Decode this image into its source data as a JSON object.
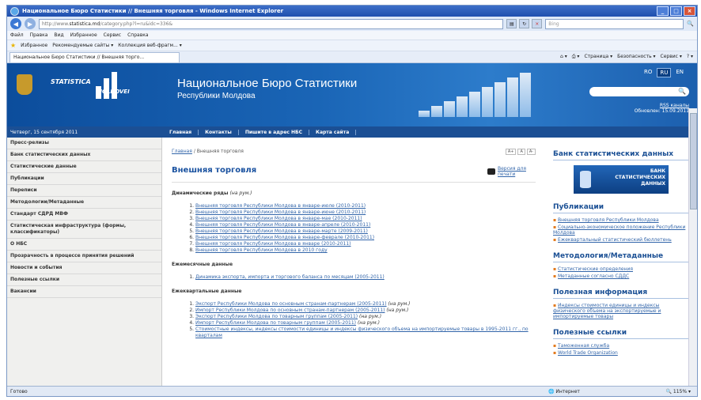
{
  "window": {
    "title": "Национальное Бюро Статистики // Внешняя торговля - Windows Internet Explorer"
  },
  "address": {
    "url_prefix": "http://www.",
    "url_host": "statistica.md",
    "url_rest": "/category.php?l=ru&idc=336&",
    "search_placeholder": "Bing"
  },
  "menubar": [
    "Файл",
    "Правка",
    "Вид",
    "Избранное",
    "Сервис",
    "Справка"
  ],
  "favorites": {
    "label": "Избранное",
    "item1": "Рекомендуемые сайты ▾",
    "item2": "Коллекция веб-фрагм... ▾"
  },
  "tab": {
    "label": "Национальное Бюро Статистики // Внешняя торго..."
  },
  "commandbar": [
    "Страница ▾",
    "Безопасность ▾",
    "Сервис ▾"
  ],
  "banner": {
    "logo_statistica": "STATISTICA",
    "logo_moldovei": "MOLDOVEI",
    "title": "Национальное Бюро Статистики",
    "subtitle": "Республики Молдова",
    "langs": [
      "RO",
      "RU",
      "EN"
    ],
    "rss": "RSS каналы",
    "updated": "Обновлен: 15.09.2011"
  },
  "navstrip": {
    "date": "Четверг, 15 сентября 2011",
    "links": [
      "Главная",
      "Контакты",
      "Пишите в адрес НБС",
      "Карта сайта"
    ]
  },
  "leftnav": [
    "Пресс-релизы",
    "Банк статистических данных",
    "Статистические данные",
    "Публикации",
    "Переписи",
    "Методологии/Метаданные",
    "Стандарт СДРД МВФ",
    "Статистическая инфраструктура (формы, классификаторы)",
    "О НБС",
    "Прозрачность в процессе принятия решений",
    "Новости и события",
    "Полезные ссылки",
    "Вакансии"
  ],
  "main": {
    "crumb_home": "Главная",
    "crumb_current": "Внешняя торговля",
    "font_buttons": [
      "A+",
      "A",
      "A-"
    ],
    "title": "Внешняя торговля",
    "print_label": "Версия для печати",
    "section1": {
      "label": "Динамические ряды",
      "note": "(на рум.)"
    },
    "list1": [
      "Внешняя торговля Республики Молдова в январе-июле (2010-2011)",
      "Внешняя торговля Республики Молдова в январе-июне (2010-2011)",
      "Внешняя торговля Республики Молдова в январе-мае (2010-2011)",
      "Внешняя торговля Республики Молдова в январе-апреле (2010-2011)",
      "Внешняя торговля Республики Молдова в январе-марте (2009-2011)",
      "Внешняя торговля Республики Молдова в январе-феврале (2010-2011)",
      "Внешняя торговля Республики Молдова в январе (2010-2011)",
      "Внешняя торговля Республики Молдова в 2010 году"
    ],
    "section2": {
      "label": "Ежемесячные данные"
    },
    "list2": [
      "Динамика экспорта, импорта и торгового баланса по месяцам (2005-2011)"
    ],
    "section3": {
      "label": "Ежеквартальные данные"
    },
    "list3": [
      {
        "text": "Экспорт Республики Молдова по основным странам-партнерам (2005-2011)",
        "note": "(на рум.)"
      },
      {
        "text": "Импорт Республики Молдова по основным странам-партнерам (2005-2011)",
        "note": "(на рум.)"
      },
      {
        "text": "Экспорт Республики Молдова по товарным группам (2005-2011)",
        "note": "(на рум.)"
      },
      {
        "text": "Импорт Республики Молдова по товарным группам (2005-2011)",
        "note": "(на рум.)"
      },
      {
        "text": "Стоимостные индексы, индексы стоимости единицы и индексы физического объема на импортируемые товары в 1995-2011 гг., по кварталам",
        "note": ""
      }
    ]
  },
  "right": {
    "bank_title": "Банк статистических данных",
    "bank_banner": "БАНК СТАТИСТИЧЕСКИХ ДАННЫХ",
    "pub_title": "Публикации",
    "pub_links": [
      "Внешняя торговля Республики Молдова",
      "Социально-экономическое положение Республики Молдова",
      "Ежеквартальный статистический бюллетень"
    ],
    "meth_title": "Методология/Метаданные",
    "meth_links": [
      "Статистические определения",
      "Метаданные согласно СДДС"
    ],
    "info_title": "Полезная информация",
    "info_links": [
      "Индексы стоимости единицы и индексы физического объема на экспортируемые и импортируемые товары"
    ],
    "useful_title": "Полезные ссылки",
    "useful_links": [
      "Таможенная служба",
      "World Trade Organization"
    ]
  },
  "status": {
    "left": "Готово",
    "zone": "Интернет",
    "zoom": "115%"
  },
  "colors": {
    "banner": "#1a65b6",
    "nav": "#1b4f94",
    "link": "#3366aa",
    "heading": "#1a52a0"
  }
}
